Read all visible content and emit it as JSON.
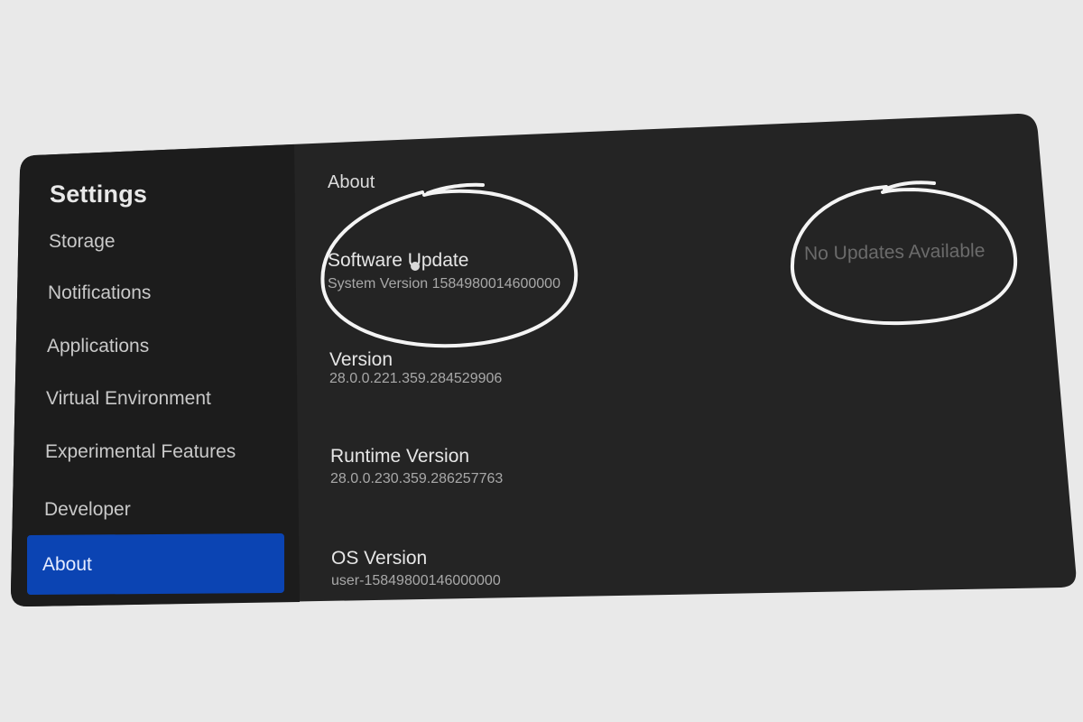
{
  "sidebar": {
    "title": "Settings",
    "items": [
      {
        "label": "Storage"
      },
      {
        "label": "Notifications"
      },
      {
        "label": "Applications"
      },
      {
        "label": "Virtual Environment"
      },
      {
        "label": "Experimental Features"
      },
      {
        "label": "Developer"
      },
      {
        "label": "About",
        "selected": true
      }
    ]
  },
  "main": {
    "heading": "About",
    "software_update": {
      "title": "Software Update",
      "subtitle": "System Version 1584980014600000",
      "status": "No Updates Available"
    },
    "version": {
      "title": "Version",
      "value": "28.0.0.221.359.284529906"
    },
    "runtime_version": {
      "title": "Runtime Version",
      "value": "28.0.0.230.359.286257763"
    },
    "os_version": {
      "title": "OS Version",
      "value": "user-15849800146000000"
    }
  },
  "colors": {
    "page_background": "#e9e9e9",
    "sidebar_background": "#1c1c1c",
    "content_background": "#242424",
    "accent": "#0b44b3",
    "annotation": "#ffffff"
  }
}
